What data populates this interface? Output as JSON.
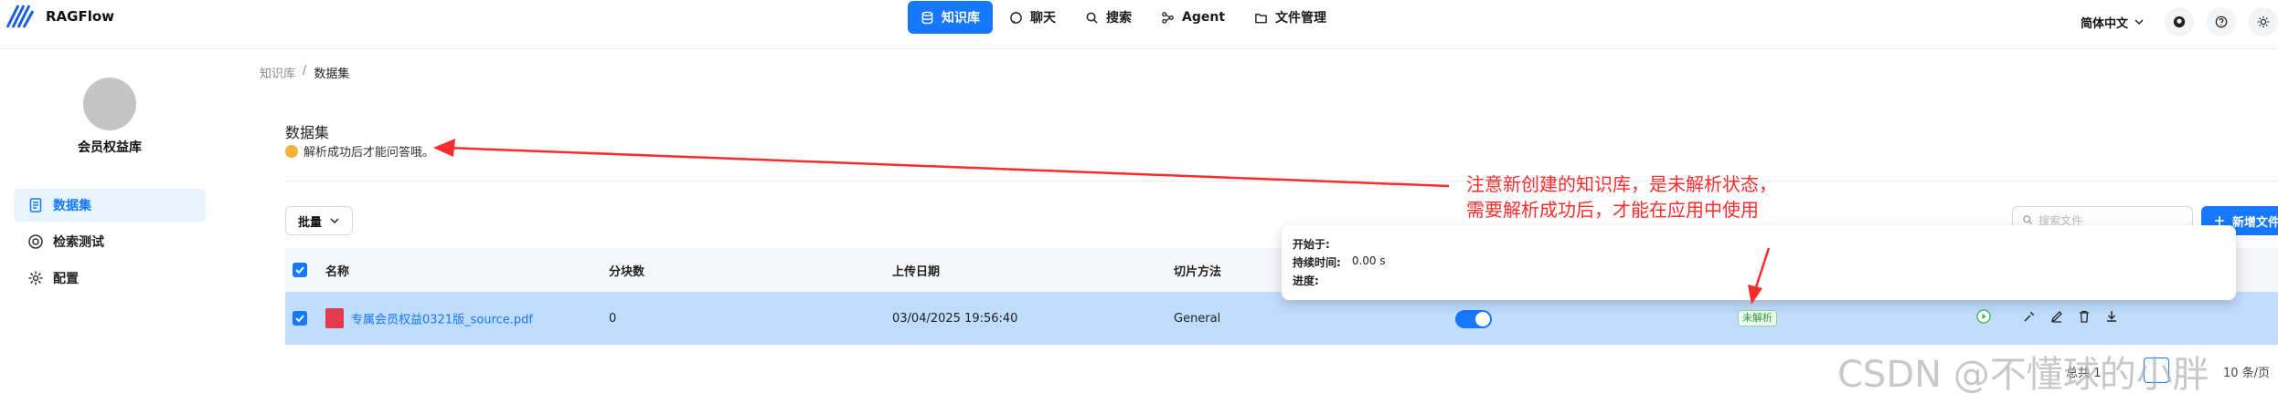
{
  "app": {
    "name": "RAGFlow"
  },
  "nav": [
    {
      "label": "知识库",
      "icon": "database-icon",
      "active": true
    },
    {
      "label": "聊天",
      "icon": "chat-icon"
    },
    {
      "label": "搜索",
      "icon": "search-icon"
    },
    {
      "label": "Agent",
      "icon": "agent-icon"
    },
    {
      "label": "文件管理",
      "icon": "folder-icon"
    }
  ],
  "header": {
    "language": "简体中文"
  },
  "sidebar": {
    "kb_name": "会员权益库",
    "items": [
      {
        "label": "数据集",
        "active": true
      },
      {
        "label": "检索测试"
      },
      {
        "label": "配置"
      }
    ]
  },
  "breadcrumb": {
    "root": "知识库",
    "sep": "/",
    "current": "数据集"
  },
  "dataset": {
    "title": "数据集",
    "tip": "解析成功后才能问答哦。",
    "batch_label": "批量",
    "search_placeholder": "搜索文件",
    "add_label": "新增文件"
  },
  "table": {
    "headers": [
      "名称",
      "分块数",
      "上传日期",
      "切片方法"
    ],
    "rows": [
      {
        "name": "专属会员权益0321版_source.pdf",
        "chunks": "0",
        "date": "03/04/2025 19:56:40",
        "method": "General",
        "status": "未解析"
      }
    ]
  },
  "popover": {
    "start_label": "开始于:",
    "duration_label": "持续时间:",
    "duration_value": "0.00 s",
    "progress_label": "进度:"
  },
  "annotation": {
    "line1": "注意新创建的知识库，是未解析状态，",
    "line2": "需要解析成功后，才能在应用中使用"
  },
  "pagination": {
    "total_text": "总共 1",
    "size_text": "10 条/页"
  },
  "watermark": "CSDN @不懂球的小胖",
  "colors": {
    "accent": "#1677ff",
    "annotation": "#ff2b2b",
    "row_selected": "#bfdcfb"
  }
}
